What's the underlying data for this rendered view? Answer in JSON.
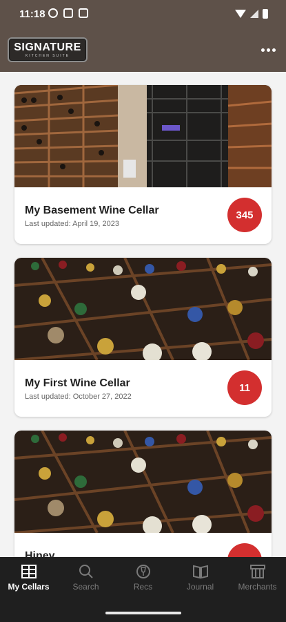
{
  "status_bar": {
    "time": "11:18"
  },
  "app_bar": {
    "logo_text": "SIGNATURE",
    "logo_subtext": "KITCHEN SUITE",
    "more_icon": "more-vertical-icon"
  },
  "cellars": [
    {
      "title": "My Basement Wine Cellar",
      "last_updated": "Last updated: April 19, 2023",
      "count": "345",
      "image": "basement-cellar-racks"
    },
    {
      "title": "My First Wine Cellar",
      "last_updated": "Last updated: October 27, 2022",
      "count": "11",
      "image": "wine-bottles-closeup"
    },
    {
      "title": "Hiney",
      "last_updated": "",
      "count": "",
      "image": "wine-bottles-closeup"
    }
  ],
  "bottom_nav": [
    {
      "label": "My Cellars",
      "icon": "cellar-grid-icon",
      "active": true
    },
    {
      "label": "Search",
      "icon": "search-icon",
      "active": false
    },
    {
      "label": "Recs",
      "icon": "recs-glass-icon",
      "active": false
    },
    {
      "label": "Journal",
      "icon": "journal-book-icon",
      "active": false
    },
    {
      "label": "Merchants",
      "icon": "storefront-icon",
      "active": false
    }
  ],
  "colors": {
    "header_bg": "#5e5149",
    "badge": "#d32f2f",
    "nav_bg": "#1f1f1f"
  }
}
